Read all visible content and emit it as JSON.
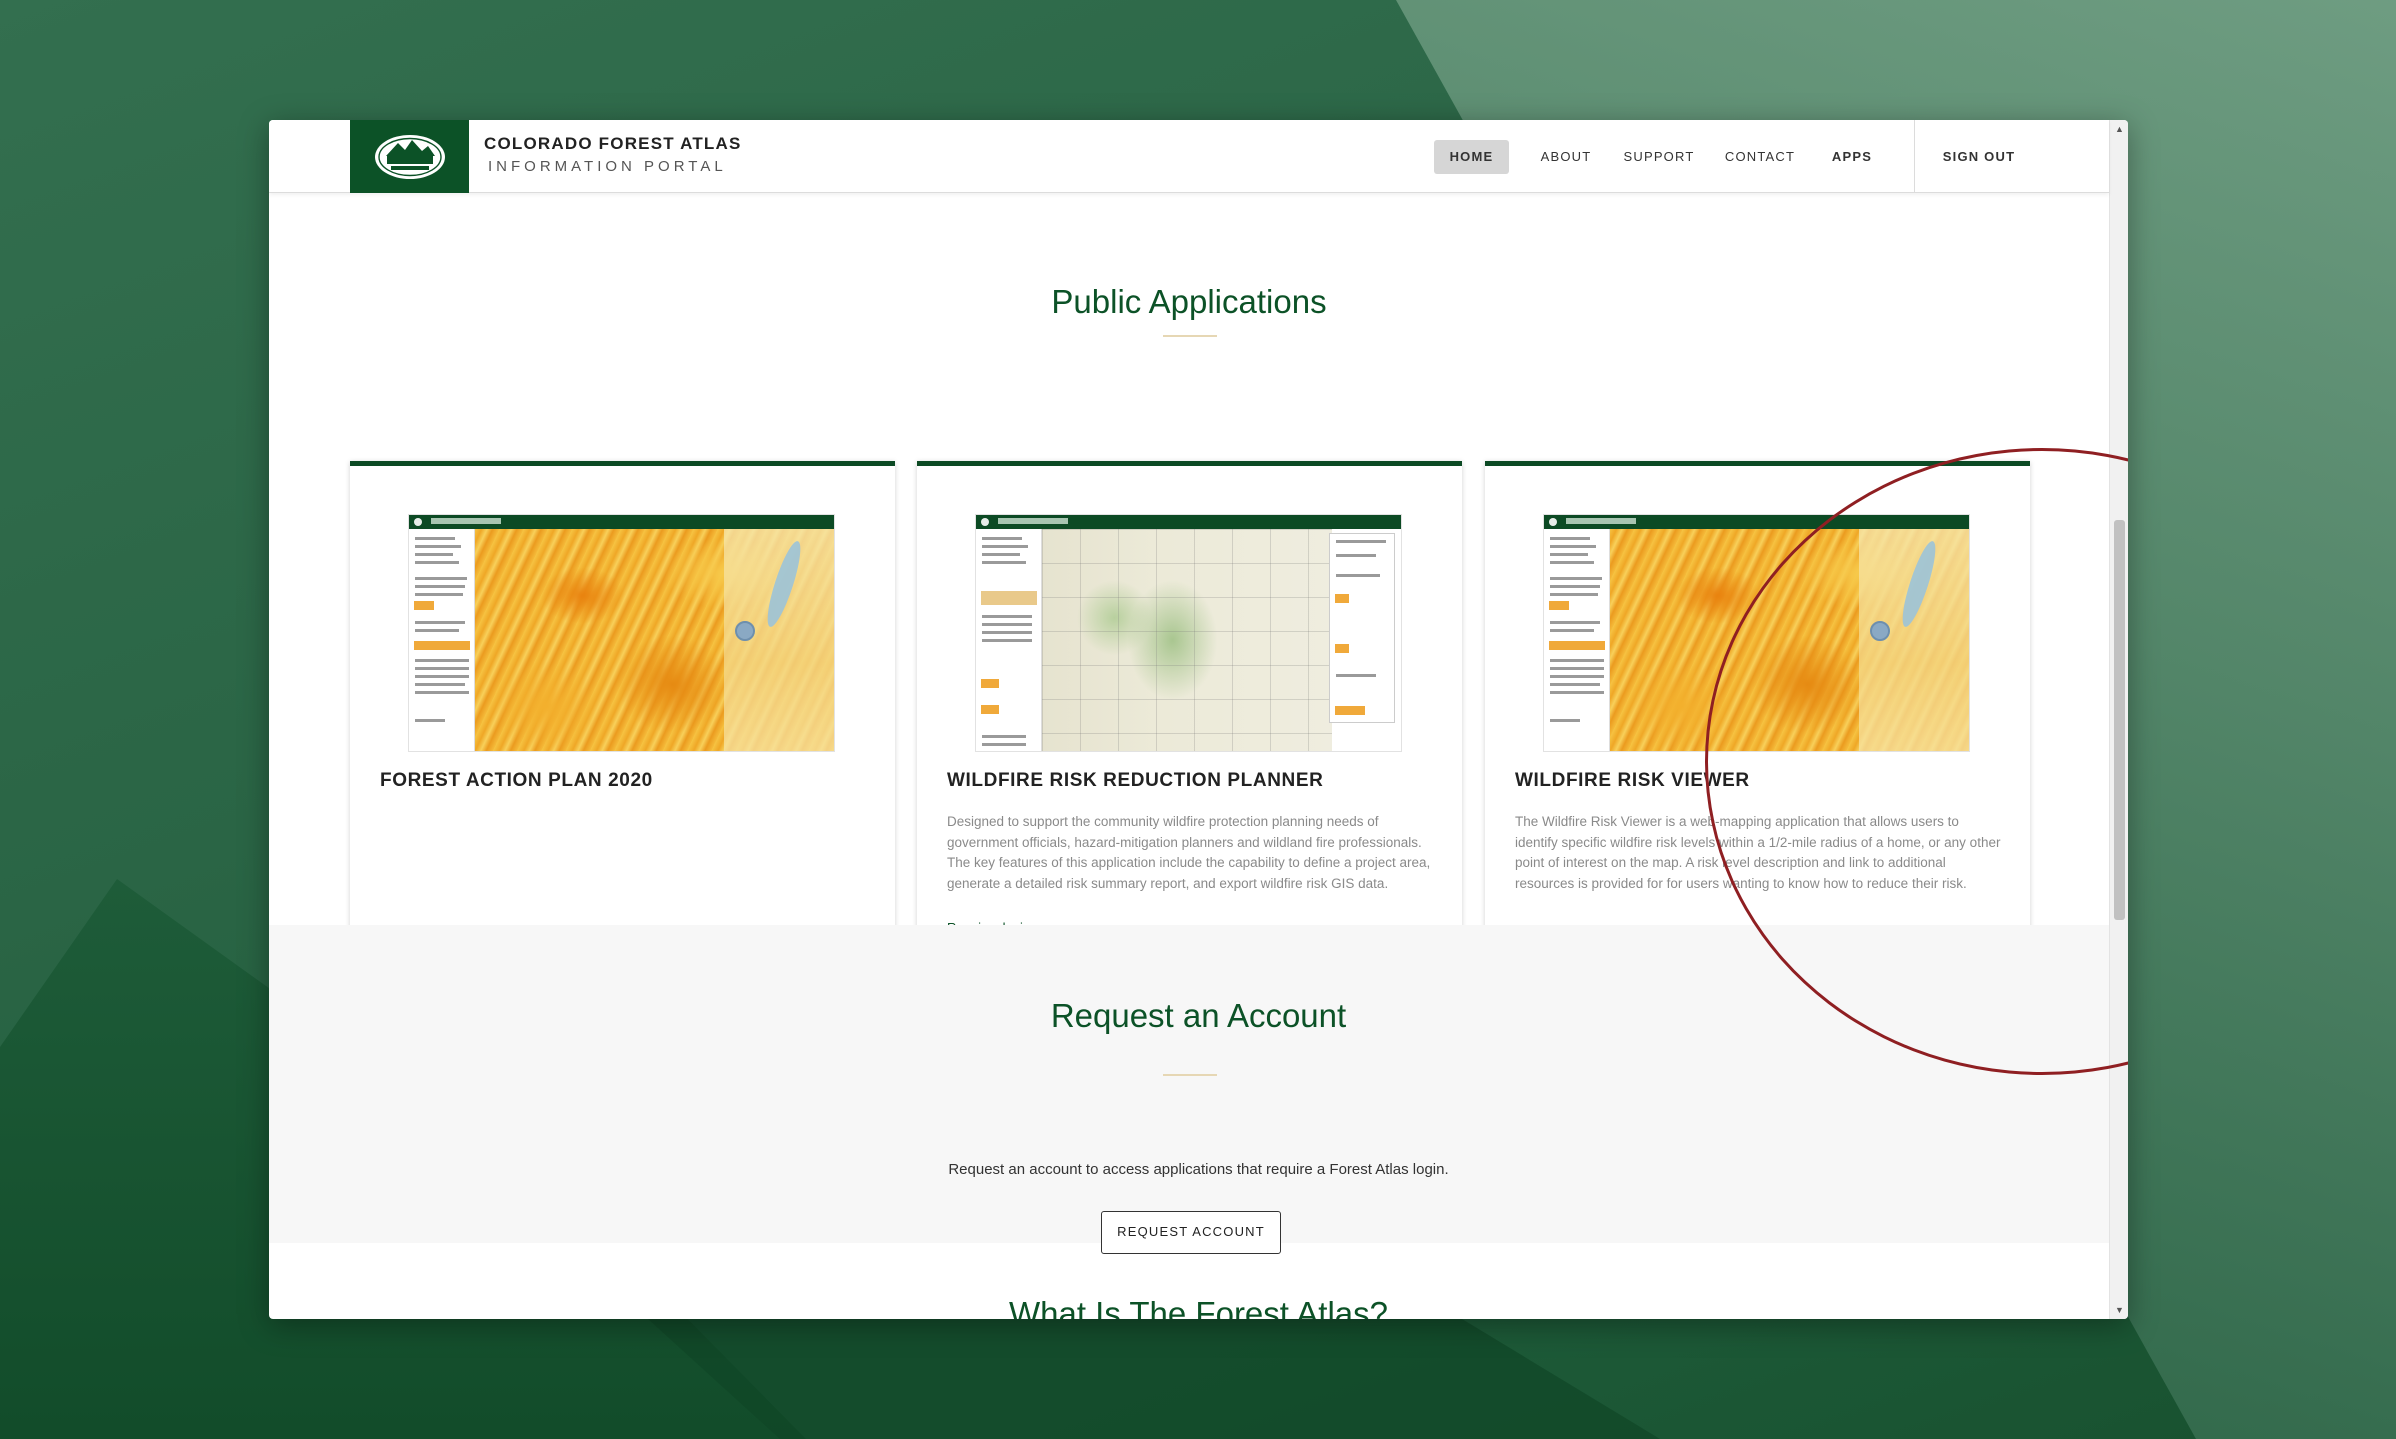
{
  "header": {
    "logo_text": "COLORADO STATE FOREST SERVICE",
    "brand_title": "COLORADO FOREST ATLAS",
    "brand_subtitle": "INFORMATION PORTAL",
    "nav": {
      "home": "HOME",
      "about": "ABOUT",
      "support": "SUPPORT",
      "contact": "CONTACT",
      "apps": "APPS",
      "sign_out": "SIGN OUT"
    },
    "active_nav": "HOME"
  },
  "public_apps": {
    "title": "Public Applications",
    "cards": [
      {
        "title": "FOREST ACTION PLAN 2020",
        "description": "",
        "link": ""
      },
      {
        "title": "WILDFIRE RISK REDUCTION PLANNER",
        "description": "Designed to support the community wildfire protection planning needs of government officials, hazard-mitigation planners and wildland fire professionals. The key features of this application include the capability to define a project area, generate a detailed risk summary report, and export wildfire risk GIS data.",
        "link": "Requires login"
      },
      {
        "title": "WILDFIRE RISK VIEWER",
        "description": "The Wildfire Risk Viewer is a web-mapping application that allows users to identify specific wildfire risk levels within a 1/2-mile radius of a home, or any other point of interest on the map. A risk level description and link to additional resources is provided for for users wanting to know how to reduce their risk.",
        "link": ""
      }
    ]
  },
  "request_account": {
    "title": "Request an Account",
    "text": "Request an account to access applications that require a Forest Atlas login.",
    "button": "REQUEST ACCOUNT"
  },
  "next_section": {
    "title": "What Is The Forest Atlas?"
  },
  "colors": {
    "brand_green": "#0c5227",
    "highlight_ring": "#8f1f22"
  }
}
